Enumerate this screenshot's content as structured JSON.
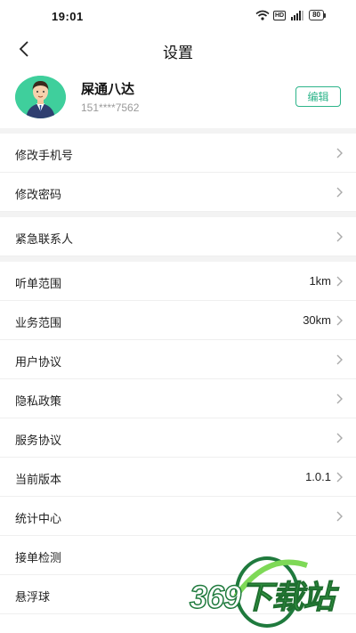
{
  "status_bar": {
    "time": "19:01",
    "hd_label": "HD",
    "battery": "80",
    "icons": [
      "wifi-icon",
      "signal-icon",
      "battery-icon"
    ]
  },
  "nav": {
    "title": "设置",
    "back_icon": "back-chevron-icon"
  },
  "profile": {
    "name": "屎通八达",
    "phone": "151****7562",
    "edit_label": "编辑",
    "accent_color": "#2db48a"
  },
  "settings": {
    "items": [
      {
        "label": "修改手机号",
        "value": "",
        "chevron": true
      },
      {
        "label": "修改密码",
        "value": "",
        "chevron": true
      },
      {
        "label": "紧急联系人",
        "value": "",
        "chevron": true
      },
      {
        "label": "听单范围",
        "value": "1km",
        "chevron": true
      },
      {
        "label": "业务范围",
        "value": "30km",
        "chevron": true
      },
      {
        "label": "用户协议",
        "value": "",
        "chevron": true
      },
      {
        "label": "隐私政策",
        "value": "",
        "chevron": true
      },
      {
        "label": "服务协议",
        "value": "",
        "chevron": true
      },
      {
        "label": "当前版本",
        "value": "1.0.1",
        "chevron": true
      },
      {
        "label": "统计中心",
        "value": "",
        "chevron": true
      },
      {
        "label": "接单检测",
        "value": "",
        "chevron": false
      },
      {
        "label": "悬浮球",
        "value": "",
        "chevron": false
      }
    ]
  },
  "watermark": {
    "number": "369",
    "text": "下载站"
  }
}
